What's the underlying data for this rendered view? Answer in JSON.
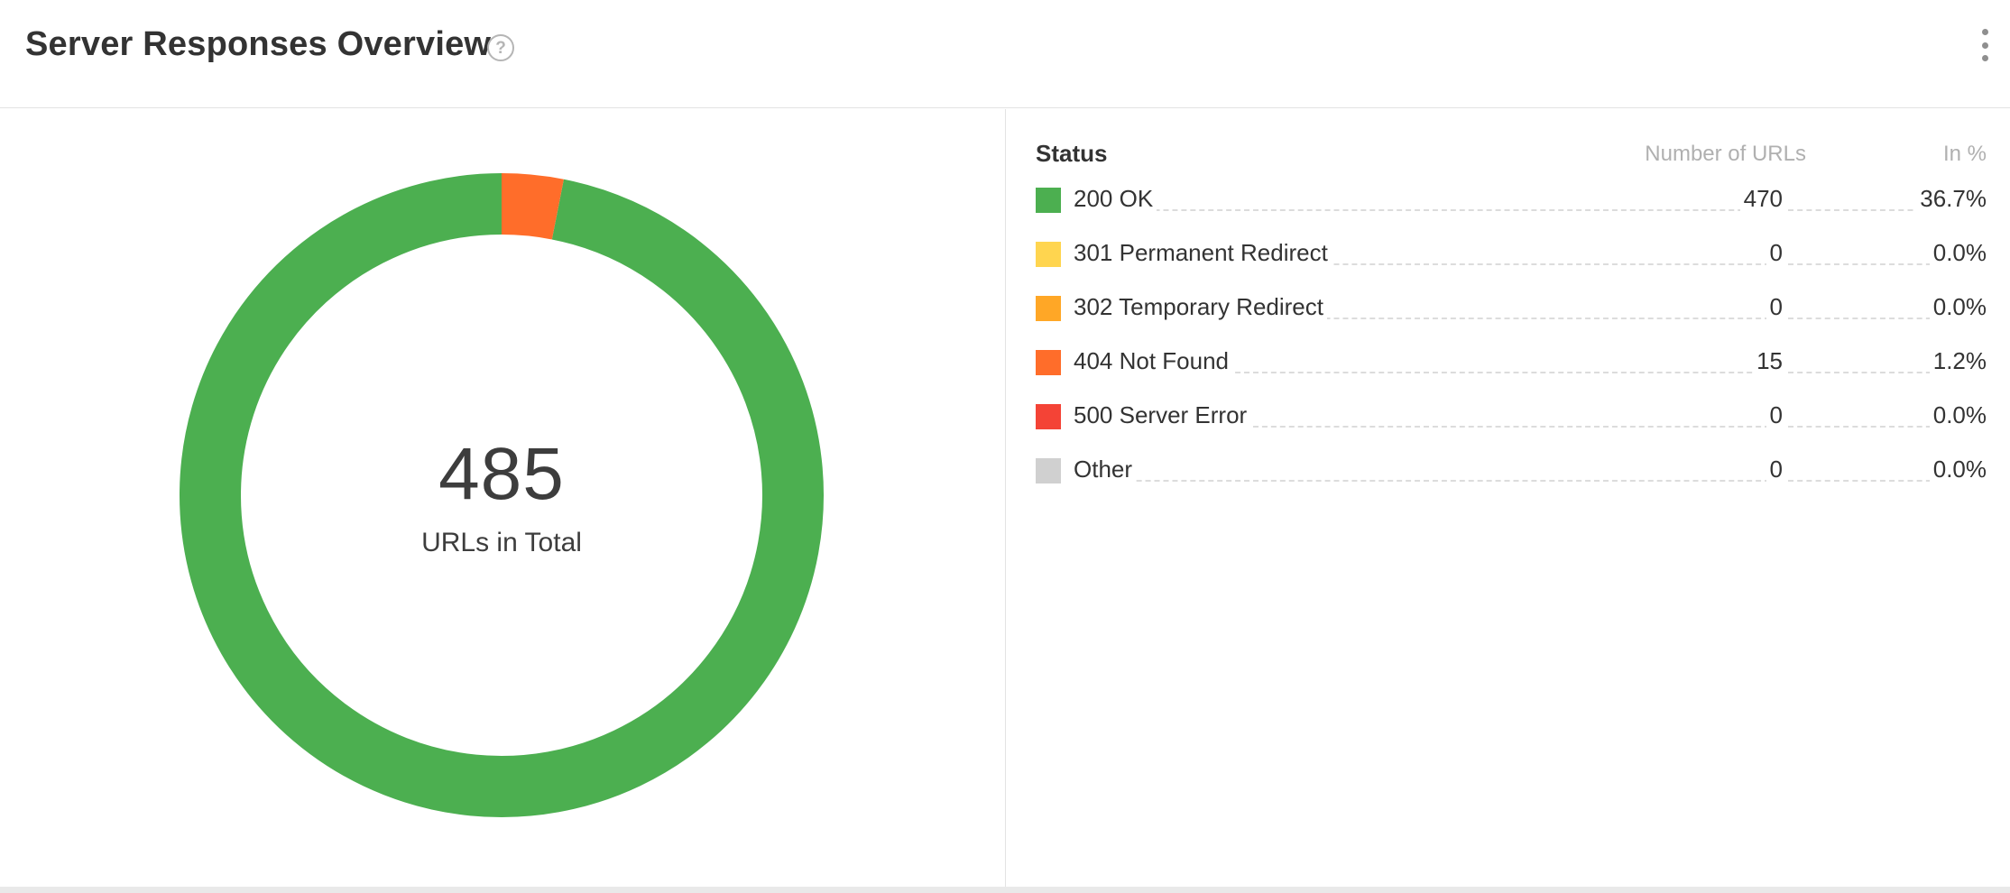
{
  "header": {
    "title": "Server Responses Overview",
    "help_icon": "question-circle-icon",
    "menu_icon": "vertical-dots-icon"
  },
  "summary": {
    "total_value": "485",
    "total_label": "URLs in Total"
  },
  "table": {
    "headers": {
      "status": "Status",
      "number": "Number of URLs",
      "percent": "In %"
    },
    "rows": [
      {
        "label": "200 OK",
        "count": "470",
        "percent": "36.7%",
        "color": "#4caf50"
      },
      {
        "label": "301 Permanent Redirect",
        "count": "0",
        "percent": "0.0%",
        "color": "#ffd54f"
      },
      {
        "label": "302 Temporary Redirect",
        "count": "0",
        "percent": "0.0%",
        "color": "#ffa726"
      },
      {
        "label": "404 Not Found",
        "count": "15",
        "percent": "1.2%",
        "color": "#ff6d2a"
      },
      {
        "label": "500 Server Error",
        "count": "0",
        "percent": "0.0%",
        "color": "#f44336"
      },
      {
        "label": "Other",
        "count": "0",
        "percent": "0.0%",
        "color": "#d0d0d0"
      }
    ]
  },
  "chart_data": {
    "type": "pie",
    "categories": [
      "200 OK",
      "301 Permanent Redirect",
      "302 Temporary Redirect",
      "404 Not Found",
      "500 Server Error",
      "Other"
    ],
    "values": [
      470,
      0,
      0,
      15,
      0,
      0
    ],
    "colors": [
      "#4caf50",
      "#ffd54f",
      "#ffa726",
      "#ff6d2a",
      "#f44336",
      "#d0d0d0"
    ],
    "donut": true
  }
}
